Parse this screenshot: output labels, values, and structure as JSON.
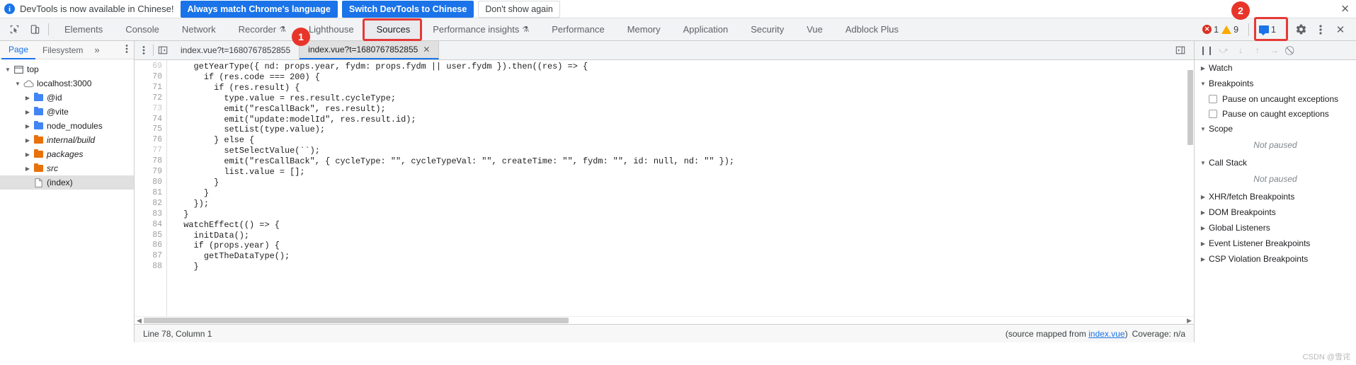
{
  "infobar": {
    "icon": "info-icon",
    "message": "DevTools is now available in Chinese!",
    "primary_button": "Always match Chrome's language",
    "secondary_button": "Switch DevTools to Chinese",
    "dismiss_button": "Don't show again",
    "close_icon": "✕"
  },
  "main_toolbar": {
    "inspect_icon": "inspect-element-icon",
    "device_icon": "device-toolbar-icon",
    "tabs": [
      {
        "label": "Elements",
        "active": false,
        "flask": false
      },
      {
        "label": "Console",
        "active": false,
        "flask": false
      },
      {
        "label": "Network",
        "active": false,
        "flask": false
      },
      {
        "label": "Recorder",
        "active": false,
        "flask": true
      },
      {
        "label": "Lighthouse",
        "active": false,
        "flask": false
      },
      {
        "label": "Sources",
        "active": true,
        "flask": false
      },
      {
        "label": "Performance insights",
        "active": false,
        "flask": true
      },
      {
        "label": "Performance",
        "active": false,
        "flask": false
      },
      {
        "label": "Memory",
        "active": false,
        "flask": false
      },
      {
        "label": "Application",
        "active": false,
        "flask": false
      },
      {
        "label": "Security",
        "active": false,
        "flask": false
      },
      {
        "label": "Vue",
        "active": false,
        "flask": false
      },
      {
        "label": "Adblock Plus",
        "active": false,
        "flask": false
      }
    ],
    "error_count": "1",
    "warning_count": "9",
    "message_count": "1",
    "settings_icon": "gear-icon",
    "kebab_icon": "more-options-icon",
    "close_icon": "✕"
  },
  "annotations": [
    {
      "label": "1",
      "target": "sources-file-tab"
    },
    {
      "label": "2",
      "target": "settings-gear-button"
    }
  ],
  "navigator": {
    "tabs": [
      {
        "label": "Page",
        "active": true
      },
      {
        "label": "Filesystem",
        "active": false
      }
    ],
    "more_icon": "»",
    "kebab_icon": "⋮",
    "tree": [
      {
        "label": "top",
        "indent": 0,
        "twisty": "▼",
        "icon": "frame-icon",
        "italic": false,
        "selected": false
      },
      {
        "label": "localhost:3000",
        "indent": 1,
        "twisty": "▼",
        "icon": "cloud-icon",
        "italic": false,
        "selected": false
      },
      {
        "label": "@id",
        "indent": 2,
        "twisty": "▶",
        "icon": "folder-blue",
        "italic": false,
        "selected": false
      },
      {
        "label": "@vite",
        "indent": 2,
        "twisty": "▶",
        "icon": "folder-blue",
        "italic": false,
        "selected": false
      },
      {
        "label": "node_modules",
        "indent": 2,
        "twisty": "▶",
        "icon": "folder-blue",
        "italic": false,
        "selected": false
      },
      {
        "label": "internal/build",
        "indent": 2,
        "twisty": "▶",
        "icon": "folder-orange",
        "italic": true,
        "selected": false
      },
      {
        "label": "packages",
        "indent": 2,
        "twisty": "▶",
        "icon": "folder-orange",
        "italic": true,
        "selected": false
      },
      {
        "label": "src",
        "indent": 2,
        "twisty": "▶",
        "icon": "folder-orange",
        "italic": true,
        "selected": false
      },
      {
        "label": "(index)",
        "indent": 2,
        "twisty": "",
        "icon": "document-icon",
        "italic": false,
        "selected": true
      }
    ]
  },
  "editor": {
    "navigator_toggle_icon": "show-navigator-icon",
    "tabs": [
      {
        "label": "index.vue?t=1680767852855",
        "active": false,
        "closable": false
      },
      {
        "label": "index.vue?t=1680767852855",
        "active": true,
        "closable": true
      }
    ],
    "close_icon": "✕",
    "format_icon": "pretty-print-icon",
    "first_line_number": 69,
    "lines": [
      {
        "n": 69,
        "text": "    getYearType({ nd: props.year, fydm: props.fydm || user.fydm }).then((res) => {",
        "dim": true
      },
      {
        "n": 70,
        "text": "      if (res.code === 200) {",
        "dim": false
      },
      {
        "n": 71,
        "text": "        if (res.result) {",
        "dim": false
      },
      {
        "n": 72,
        "text": "          type.value = res.result.cycleType;",
        "dim": false
      },
      {
        "n": 73,
        "text": "          emit(\"resCallBack\", res.result);",
        "dim": true
      },
      {
        "n": 74,
        "text": "          emit(\"update:modelId\", res.result.id);",
        "dim": false
      },
      {
        "n": 75,
        "text": "          setList(type.value);",
        "dim": false
      },
      {
        "n": 76,
        "text": "        } else {",
        "dim": false
      },
      {
        "n": 77,
        "text": "          setSelectValue(``);",
        "dim": true
      },
      {
        "n": 78,
        "text": "          emit(\"resCallBack\", { cycleType: \"\", cycleTypeVal: \"\", createTime: \"\", fydm: \"\", id: null, nd: \"\" });",
        "dim": false
      },
      {
        "n": 79,
        "text": "          list.value = [];",
        "dim": false
      },
      {
        "n": 80,
        "text": "        }",
        "dim": false
      },
      {
        "n": 81,
        "text": "      }",
        "dim": false
      },
      {
        "n": 82,
        "text": "    });",
        "dim": false
      },
      {
        "n": 83,
        "text": "  }",
        "dim": false
      },
      {
        "n": 84,
        "text": "  watchEffect(() => {",
        "dim": false
      },
      {
        "n": 85,
        "text": "    initData();",
        "dim": false
      },
      {
        "n": 86,
        "text": "    if (props.year) {",
        "dim": false
      },
      {
        "n": 87,
        "text": "      getTheDataType();",
        "dim": false
      },
      {
        "n": 88,
        "text": "    }",
        "dim": false
      }
    ]
  },
  "statusbar": {
    "cursor": "Line 78, Column 1",
    "source_map_prefix": "(source mapped from ",
    "source_map_link": "index.vue",
    "source_map_suffix": ")",
    "coverage": "Coverage: n/a"
  },
  "debugger": {
    "toolbar_icons": [
      {
        "name": "pause-script-icon",
        "glyph": "❙❙",
        "disabled": false
      },
      {
        "name": "step-over-icon",
        "glyph": "⤻",
        "disabled": true
      },
      {
        "name": "step-into-icon",
        "glyph": "↓",
        "disabled": true
      },
      {
        "name": "step-out-icon",
        "glyph": "↑",
        "disabled": true
      },
      {
        "name": "step-icon",
        "glyph": "→",
        "disabled": true
      },
      {
        "name": "deactivate-breakpoints-icon",
        "glyph": "⃠",
        "disabled": false
      }
    ],
    "sections": [
      {
        "label": "Watch",
        "expanded": false,
        "type": "plain"
      },
      {
        "label": "Breakpoints",
        "expanded": true,
        "type": "breakpoints"
      },
      {
        "label": "Scope",
        "expanded": true,
        "type": "status",
        "status": "Not paused"
      },
      {
        "label": "Call Stack",
        "expanded": true,
        "type": "status",
        "status": "Not paused"
      },
      {
        "label": "XHR/fetch Breakpoints",
        "expanded": false,
        "type": "plain"
      },
      {
        "label": "DOM Breakpoints",
        "expanded": false,
        "type": "plain"
      },
      {
        "label": "Global Listeners",
        "expanded": false,
        "type": "plain"
      },
      {
        "label": "Event Listener Breakpoints",
        "expanded": false,
        "type": "plain"
      },
      {
        "label": "CSP Violation Breakpoints",
        "expanded": false,
        "type": "plain"
      }
    ],
    "breakpoint_options": [
      {
        "label": "Pause on uncaught exceptions",
        "checked": false
      },
      {
        "label": "Pause on caught exceptions",
        "checked": false
      }
    ],
    "expanded_caret": "▼",
    "collapsed_caret": "▶"
  },
  "watermark": "CSDN @雪诧",
  "colors": {
    "accent": "#1a73e8",
    "toolbar_bg": "#f1f3f4",
    "active_tab_bg": "#e8eaed",
    "error": "#d93025",
    "warning": "#f9ab00",
    "annotation": "#e8352a",
    "folder_blue": "#4285f4",
    "folder_orange": "#e8710a"
  }
}
